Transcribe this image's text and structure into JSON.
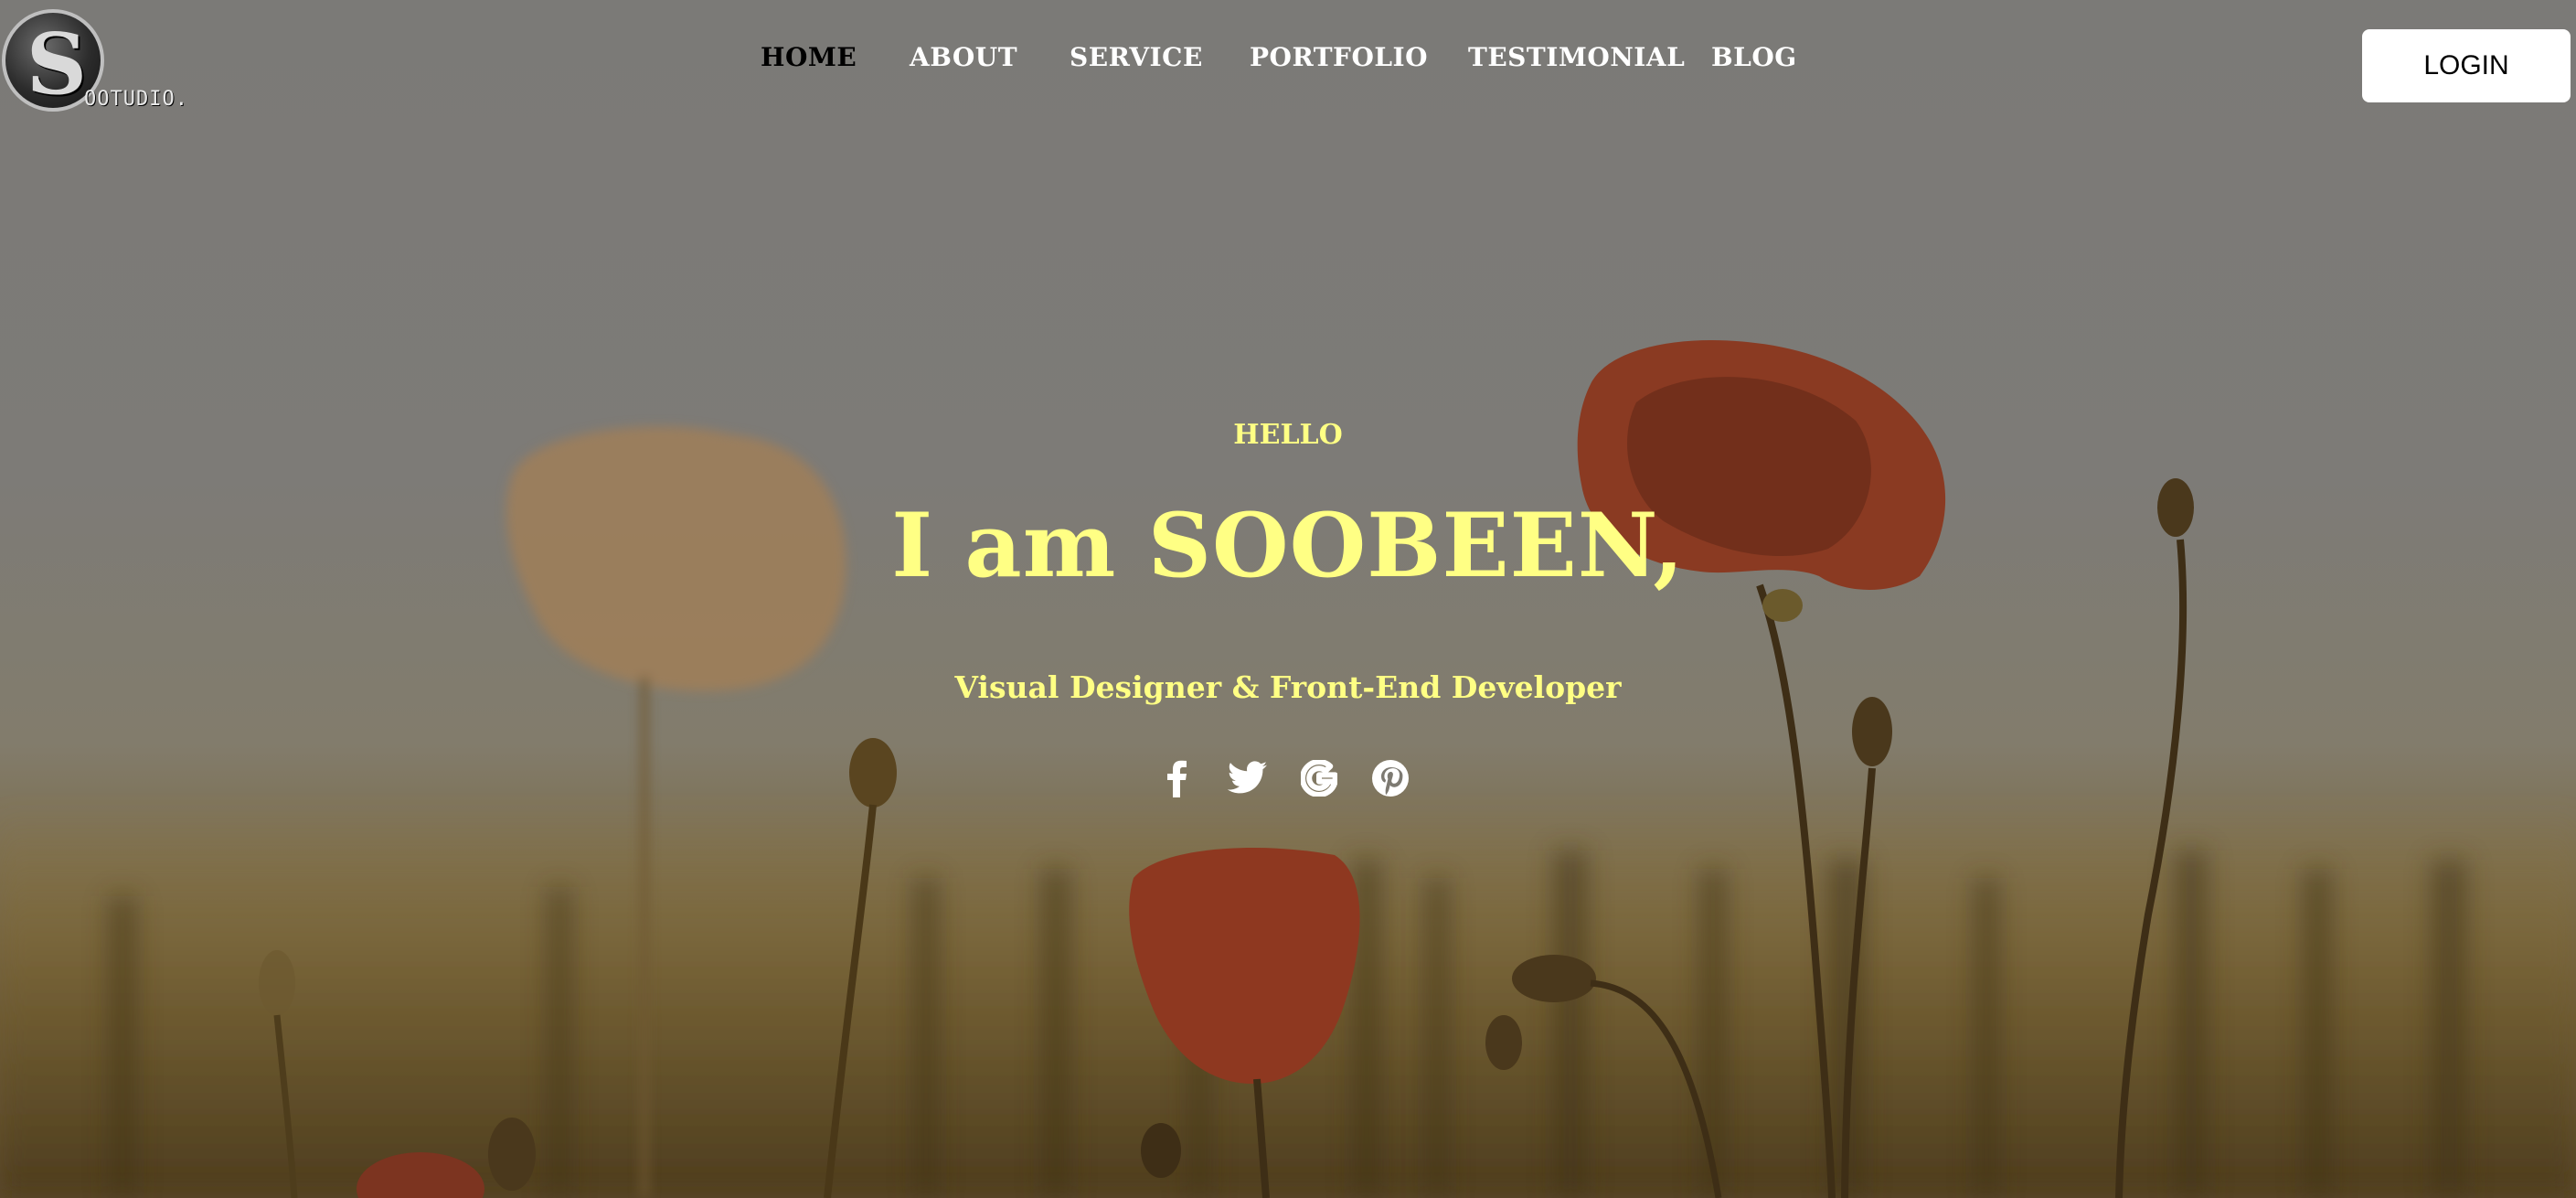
{
  "logo": {
    "badge_letter": "S",
    "rest_text": "OOTUDIO."
  },
  "nav": {
    "items": [
      {
        "label": "HOME",
        "active": true
      },
      {
        "label": "ABOUT",
        "active": false
      },
      {
        "label": "SERVICE",
        "active": false
      },
      {
        "label": "PORTFOLIO",
        "active": false
      },
      {
        "label": "TESTIMONIAL",
        "active": false
      },
      {
        "label": "BLOG",
        "active": false
      }
    ]
  },
  "login": {
    "label": "LOGIN"
  },
  "hero": {
    "greeting": "HELLO",
    "headline": "I am SOOBEEN,",
    "subtitle": "Visual Designer & Front-End Developer",
    "text_color": "#ffff84",
    "social_icons": [
      "facebook-icon",
      "twitter-icon",
      "google-icon",
      "pinterest-icon"
    ]
  },
  "colors": {
    "nav_active": "#000000",
    "nav_default": "#ffffff",
    "login_bg": "#ffffff"
  }
}
